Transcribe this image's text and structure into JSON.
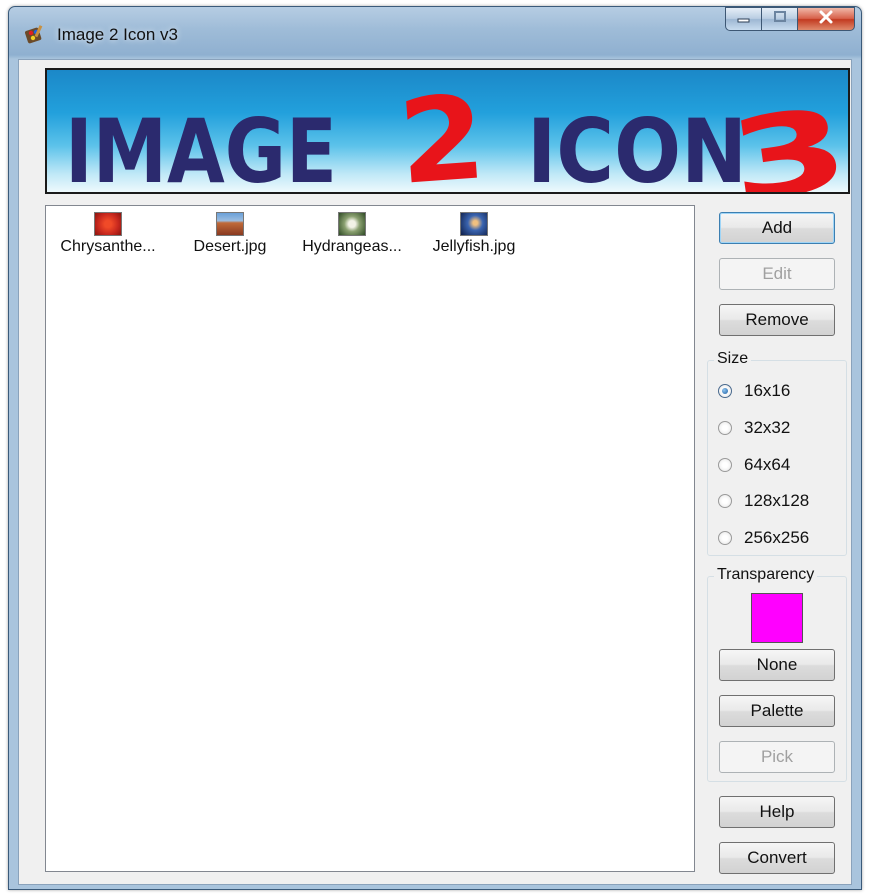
{
  "window": {
    "title": "Image 2 Icon v3"
  },
  "banner": {
    "word1": "IMAGE",
    "word2": "2",
    "word3": "ICON",
    "word4": "3"
  },
  "files": [
    {
      "name": "Chrysanthe...",
      "thumb_color": "#c8281e"
    },
    {
      "name": "Desert.jpg",
      "thumb_color": "#a8502c"
    },
    {
      "name": "Hydrangeas...",
      "thumb_color": "#5a6e3a"
    },
    {
      "name": "Jellyfish.jpg",
      "thumb_color": "#20407a"
    }
  ],
  "buttons": {
    "add": "Add",
    "edit": "Edit",
    "remove": "Remove",
    "none": "None",
    "palette": "Palette",
    "pick": "Pick",
    "help": "Help",
    "convert": "Convert"
  },
  "size_group": {
    "label": "Size",
    "options": [
      "16x16",
      "32x32",
      "64x64",
      "128x128",
      "256x256"
    ],
    "selected": "16x16"
  },
  "transparency_group": {
    "label": "Transparency",
    "color": "#ff00ff"
  },
  "colors": {
    "banner_text": "#2b2a6e",
    "banner_accent": "#e8141a"
  }
}
